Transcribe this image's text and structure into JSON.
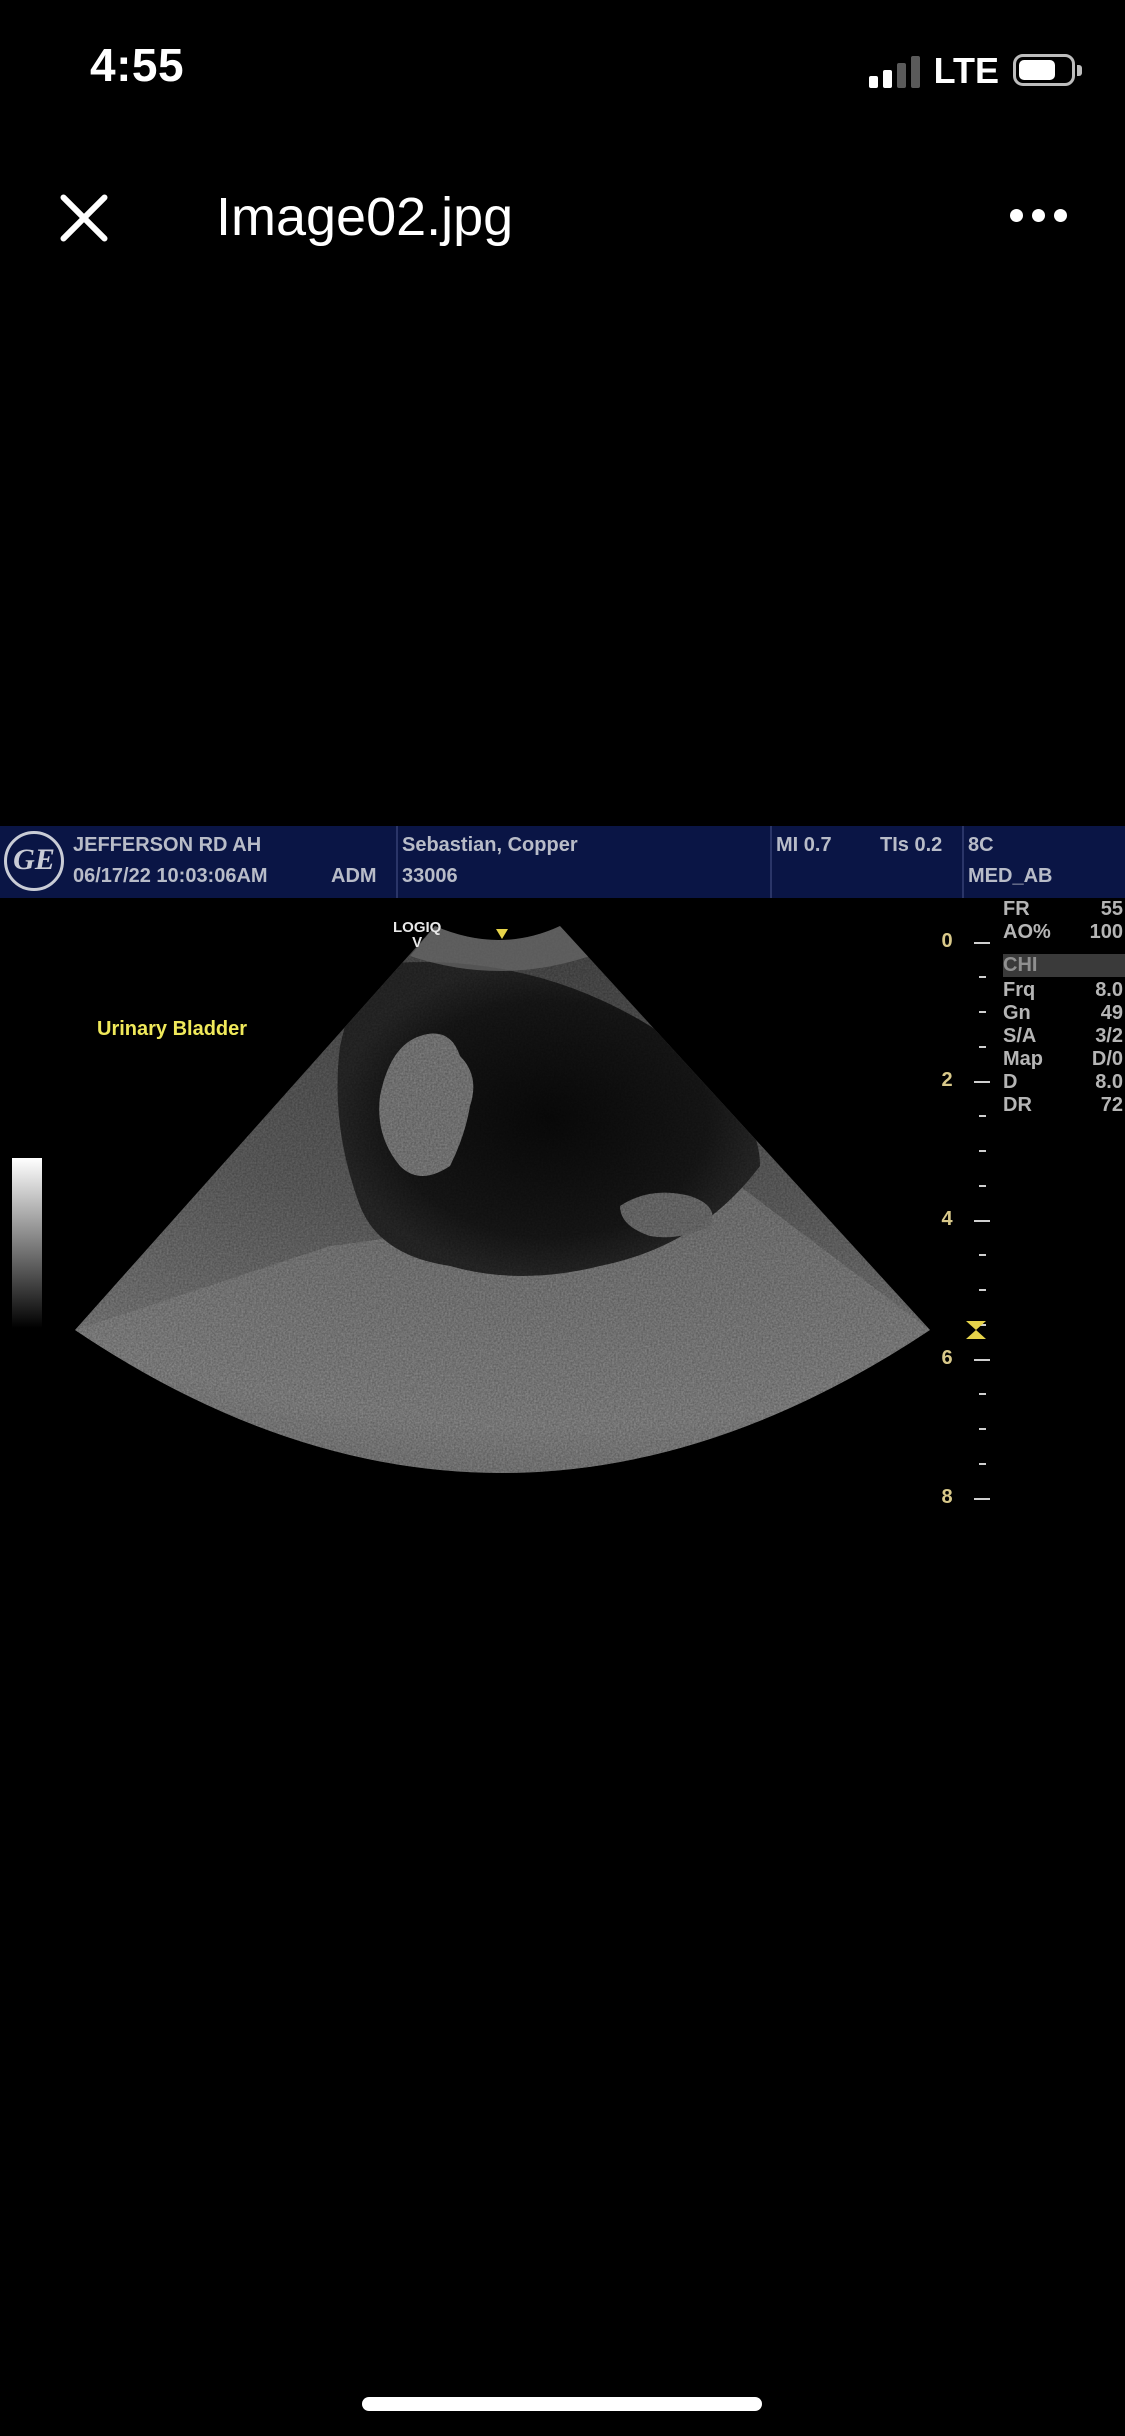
{
  "status_bar": {
    "time": "4:55",
    "network": "LTE",
    "signal_bars": 2,
    "battery_level": 0.75
  },
  "nav": {
    "title": "Image02.jpg",
    "close_icon": "close-icon",
    "more_icon": "more-horizontal-icon"
  },
  "image": {
    "header": {
      "logo_text": "GE",
      "site": "JEFFERSON RD AH",
      "datetime": "06/17/22 10:03:06AM",
      "operator": "ADM",
      "patient_name": "Sebastian, Copper",
      "patient_id": "33006",
      "mi": "MI 0.7",
      "tis": "TIs 0.2",
      "probe": "8C",
      "preset": "MED_AB"
    },
    "annotation": "Urinary Bladder",
    "scanner_label_line1": "LOGIQ",
    "scanner_label_line2": "V",
    "depth_labels": [
      "0",
      "2",
      "4",
      "6",
      "8"
    ],
    "params": [
      {
        "key": "FR",
        "value": "55"
      },
      {
        "key": "AO%",
        "value": "100"
      },
      {
        "key": "CHI",
        "value": ""
      },
      {
        "key": "Frq",
        "value": "8.0"
      },
      {
        "key": "Gn",
        "value": "49"
      },
      {
        "key": "S/A",
        "value": "3/2"
      },
      {
        "key": "Map",
        "value": "D/0"
      },
      {
        "key": "D",
        "value": "8.0"
      },
      {
        "key": "DR",
        "value": "72"
      }
    ]
  },
  "colors": {
    "background": "#000000",
    "header_bg": "#0a1545",
    "annotation": "#f0e95a",
    "marker": "#e6d34a"
  }
}
